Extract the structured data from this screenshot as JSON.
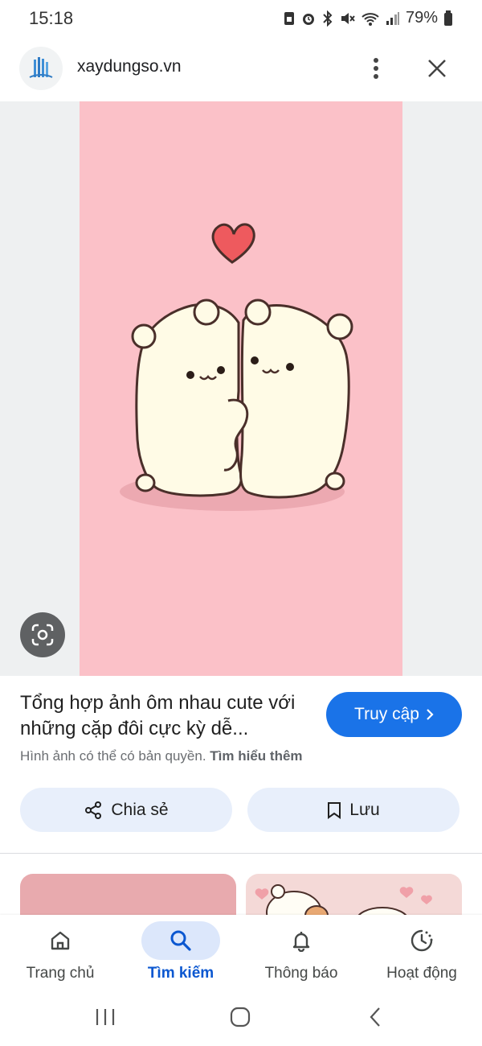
{
  "status_bar": {
    "time": "15:18",
    "battery": "79%",
    "icons": [
      "sim-icon",
      "alarm-icon",
      "bluetooth-icon",
      "mute-icon",
      "wifi-icon",
      "signal-icon",
      "battery-icon"
    ]
  },
  "header": {
    "domain": "xaydungso.vn",
    "logo_icon": "building-logo-icon",
    "more_icon": "more-vert-icon",
    "close_icon": "close-icon"
  },
  "image": {
    "background_color": "#fbc1c8",
    "lens_icon": "google-lens-icon"
  },
  "info": {
    "title": "Tổng hợp ảnh ôm nhau cute với những cặp đôi cực kỳ dễ...",
    "visit_label": "Truy cập",
    "copyright_text": "Hình ảnh có thể có bản quyền.",
    "learn_more": "Tìm hiểu thêm",
    "share_label": "Chia sẻ",
    "save_label": "Lưu"
  },
  "bottom_nav": {
    "items": [
      {
        "label": "Trang chủ",
        "icon": "home-icon",
        "active": false
      },
      {
        "label": "Tìm kiếm",
        "icon": "search-icon",
        "active": true
      },
      {
        "label": "Thông báo",
        "icon": "bell-icon",
        "active": false
      },
      {
        "label": "Hoạt động",
        "icon": "activity-icon",
        "active": false
      }
    ]
  },
  "colors": {
    "accent": "#1a73e8",
    "active_nav": "#0b57d0",
    "pill": "#dce7fb"
  }
}
